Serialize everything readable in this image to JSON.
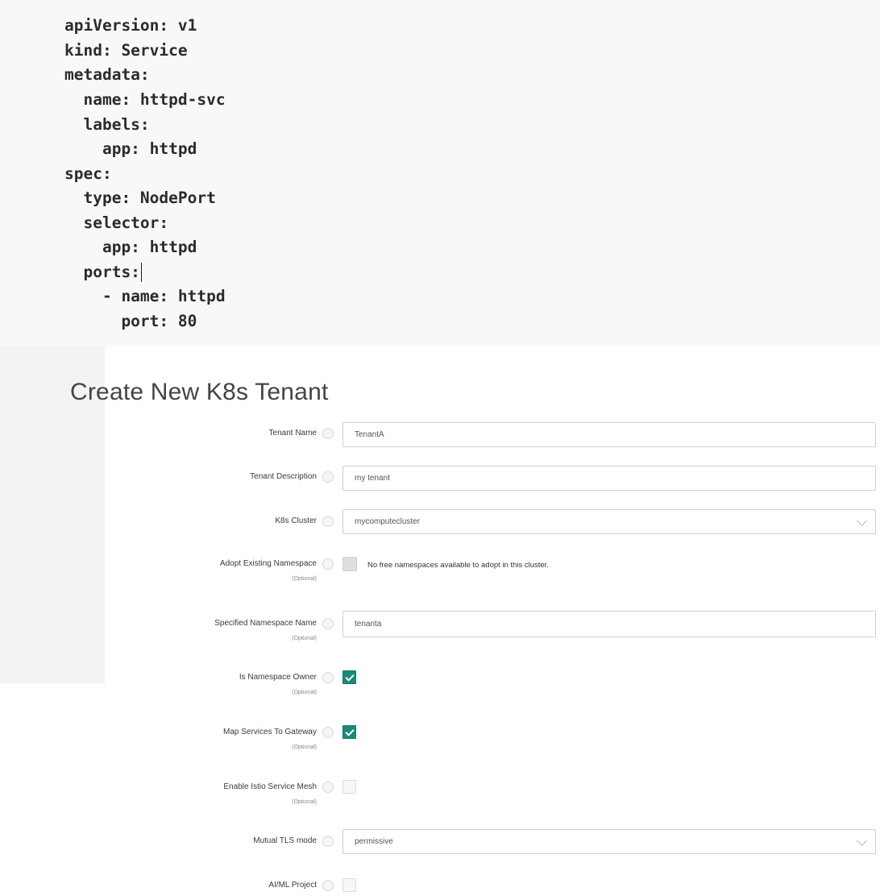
{
  "code": {
    "lines": [
      "apiVersion: v1",
      "kind: Service",
      "metadata:",
      "  name: httpd-svc",
      "  labels:",
      "    app: httpd",
      "spec:",
      "  type: NodePort",
      "  selector:",
      "    app: httpd",
      "  ports:",
      "    - name: httpd",
      "      port: 80"
    ]
  },
  "form": {
    "title": "Create New K8s Tenant",
    "optional_label": "(Optional)",
    "tenant_name": {
      "label": "Tenant Name",
      "value": "TenantA"
    },
    "tenant_description": {
      "label": "Tenant Description",
      "value": "my tenant"
    },
    "k8s_cluster": {
      "label": "K8s Cluster",
      "value": "mycomputecluster"
    },
    "adopt_namespace": {
      "label": "Adopt Existing Namespace",
      "note": "No free namespaces available to adopt in this cluster."
    },
    "specified_namespace": {
      "label": "Specified Namespace Name",
      "value": "tenanta"
    },
    "namespace_owner": {
      "label": "Is Namespace Owner",
      "checked": true
    },
    "map_services": {
      "label": "Map Services To Gateway",
      "checked": true
    },
    "istio_mesh": {
      "label": "Enable Istio Service Mesh",
      "checked": false
    },
    "mutual_tls": {
      "label": "Mutual TLS mode",
      "value": "permissive"
    },
    "aiml_project": {
      "label": "AI/ML Project",
      "checked": false
    }
  },
  "colors": {
    "accent": "#1a8a78"
  }
}
